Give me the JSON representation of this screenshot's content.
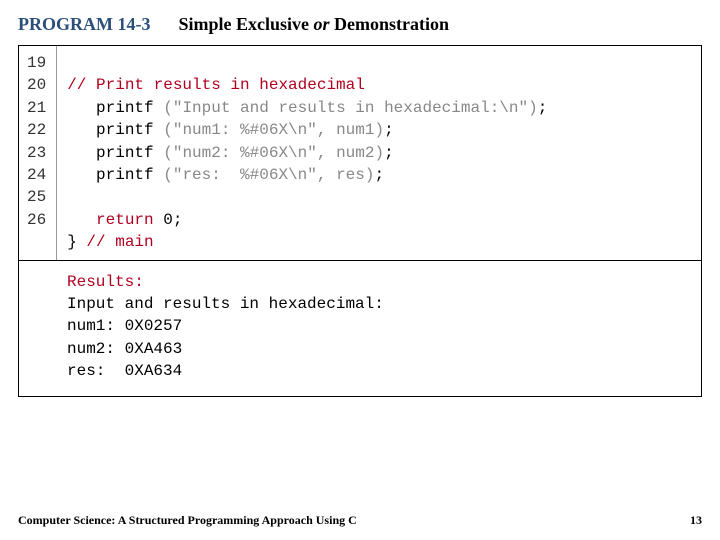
{
  "header": {
    "program_label": "PROGRAM 14-3",
    "title_prefix": "Simple Exclusive ",
    "title_italic": "or",
    "title_suffix": " Demonstration"
  },
  "code": {
    "line_numbers": [
      "19",
      "20",
      "21",
      "22",
      "23",
      "24",
      "25",
      "26"
    ],
    "lines": [
      {
        "indent": "",
        "comment": "// Print results in hexadecimal"
      },
      {
        "indent": "   ",
        "call": "printf ",
        "str": "(\"Input and results in hexadecimal:\\n\")",
        "tail": ";"
      },
      {
        "indent": "   ",
        "call": "printf ",
        "str": "(\"num1: %#06X\\n\", num1)",
        "tail": ";"
      },
      {
        "indent": "   ",
        "call": "printf ",
        "str": "(\"num2: %#06X\\n\", num2)",
        "tail": ";"
      },
      {
        "indent": "   ",
        "call": "printf ",
        "str": "(\"res:  %#06X\\n\", res)",
        "tail": ";"
      },
      {
        "blank": " "
      },
      {
        "indent": "   ",
        "kw": "return",
        "tail": " 0;"
      },
      {
        "indent": "",
        "plain": "} ",
        "comment": "// main"
      }
    ]
  },
  "results": {
    "label": "Results:",
    "lines": [
      "Input and results in hexadecimal:",
      "num1: 0X0257",
      "num2: 0XA463",
      "res:  0XA634"
    ]
  },
  "footer": {
    "book": "Computer Science: A Structured Programming Approach Using C",
    "page": "13"
  }
}
